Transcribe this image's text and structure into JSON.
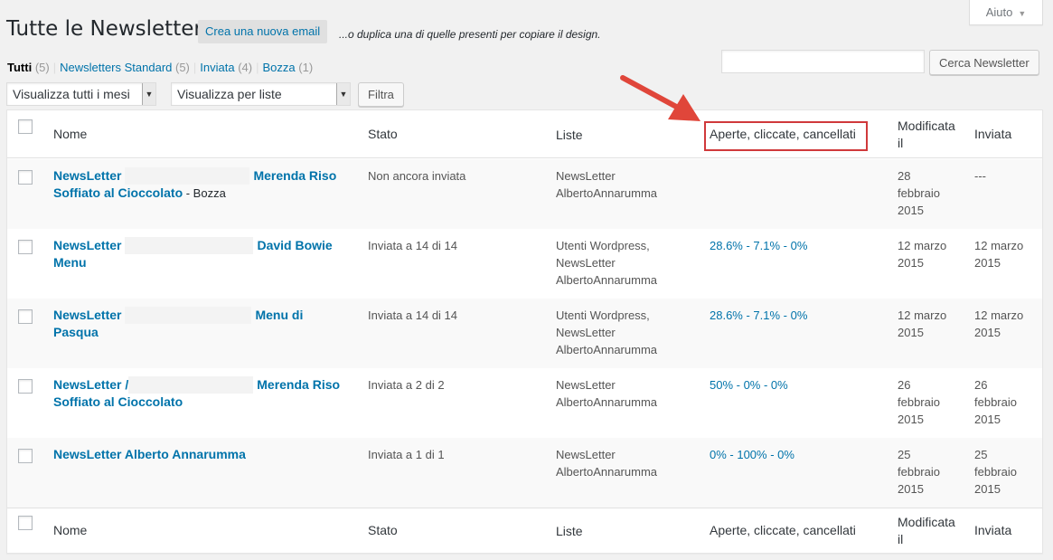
{
  "help_tab": {
    "label": "Aiuto"
  },
  "header": {
    "title": "Tutte le Newsletter",
    "new_button": "Crea una nuova email",
    "hint": "...o duplica una di quelle presenti per copiare il design."
  },
  "views": [
    {
      "label": "Tutti",
      "count": "(5)"
    },
    {
      "label": "Newsletters Standard",
      "count": "(5)"
    },
    {
      "label": "Inviata",
      "count": "(4)"
    },
    {
      "label": "Bozza",
      "count": "(1)"
    }
  ],
  "search": {
    "value": "",
    "button": "Cerca Newsletter"
  },
  "filters": {
    "months": "Visualizza tutti i mesi",
    "lists": "Visualizza per liste",
    "button": "Filtra"
  },
  "columns": {
    "name": "Nome",
    "status": "Stato",
    "lists": "Liste",
    "stats": "Aperte, cliccate, cancellati",
    "modified": "Modificata il",
    "sent": "Inviata"
  },
  "rows": [
    {
      "name_a": "NewsLetter",
      "name_b": "Merenda Riso",
      "name_c": "Soffiato al Cioccolato",
      "draft": " - Bozza",
      "status": "Non ancora inviata",
      "lists": [
        "NewsLetter",
        "AlbertoAnnarumma"
      ],
      "stats": "",
      "modified": [
        "28",
        "febbraio",
        "2015"
      ],
      "sent": [
        "---"
      ]
    },
    {
      "name_a": "NewsLetter",
      "name_b": "David Bowie",
      "name_c": "Menu",
      "draft": "",
      "status": "Inviata a 14 di 14",
      "lists": [
        "Utenti Wordpress,",
        "NewsLetter",
        "AlbertoAnnarumma"
      ],
      "stats": "28.6% - 7.1% - 0%",
      "modified": [
        "12 marzo",
        "2015"
      ],
      "sent": [
        "12 marzo",
        "2015"
      ]
    },
    {
      "name_a": "NewsLetter",
      "name_b": "Menu di",
      "name_c": "Pasqua",
      "draft": "",
      "status": "Inviata a 14 di 14",
      "lists": [
        "Utenti Wordpress,",
        "NewsLetter",
        "AlbertoAnnarumma"
      ],
      "stats": "28.6% - 7.1% - 0%",
      "modified": [
        "12 marzo",
        "2015"
      ],
      "sent": [
        "12 marzo",
        "2015"
      ]
    },
    {
      "name_a": "NewsLetter /",
      "name_b": "Merenda Riso",
      "name_c": "Soffiato al Cioccolato",
      "draft": "",
      "status": "Inviata a 2 di 2",
      "lists": [
        "NewsLetter",
        "AlbertoAnnarumma"
      ],
      "stats": "50% - 0% - 0%",
      "modified": [
        "26",
        "febbraio",
        "2015"
      ],
      "sent": [
        "26",
        "febbraio",
        "2015"
      ]
    },
    {
      "name_a": "NewsLetter Alberto Annarumma",
      "name_b": "",
      "name_c": "",
      "draft": "",
      "status": "Inviata a 1 di 1",
      "lists": [
        "NewsLetter",
        "AlbertoAnnarumma"
      ],
      "stats": "0% - 100% - 0%",
      "modified": [
        "25",
        "febbraio",
        "2015"
      ],
      "sent": [
        "25",
        "febbraio",
        "2015"
      ]
    }
  ],
  "colors": {
    "accent": "#0073aa",
    "highlight": "#d0393b",
    "arrow": "#e0463a"
  }
}
